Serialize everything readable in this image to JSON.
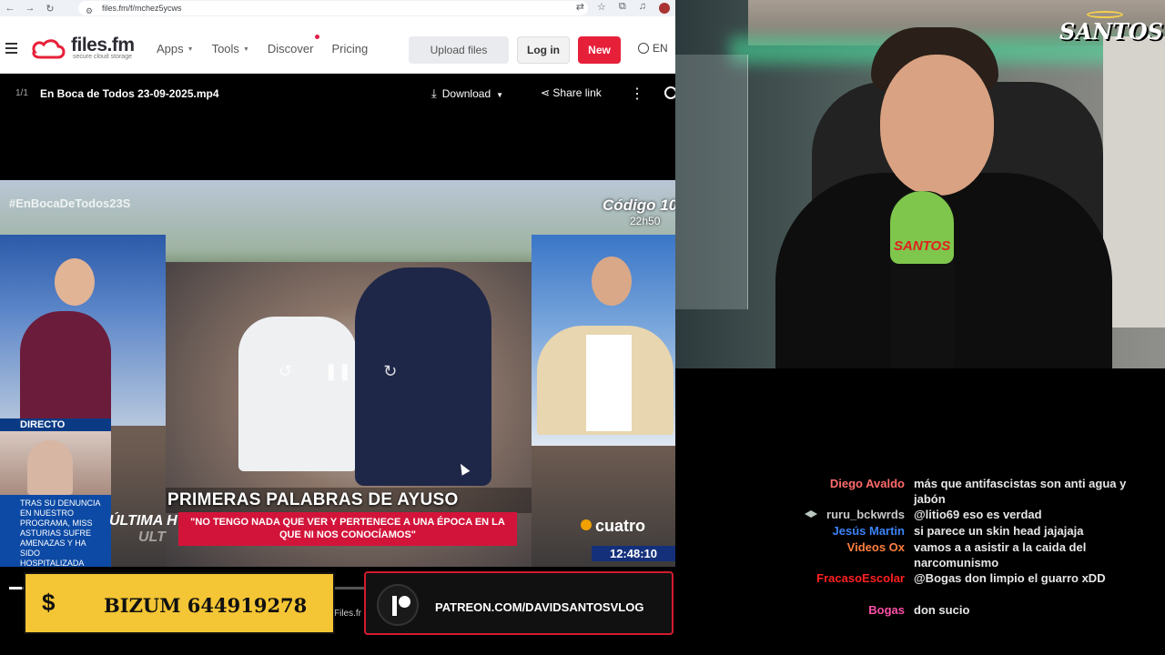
{
  "browser": {
    "url": "files.fm/f/mchez5ycws",
    "colors": {
      "brand_red": "#e7203a",
      "chrome_bg": "#eef1f5"
    }
  },
  "site": {
    "logo_text": "files.fm",
    "logo_sub": "secure cloud storage",
    "menu": [
      {
        "label": "Apps",
        "has_caret": true
      },
      {
        "label": "Tools",
        "has_caret": true
      },
      {
        "label": "Discover",
        "has_caret": false
      },
      {
        "label": "Pricing",
        "has_caret": false
      }
    ],
    "upload_label": "Upload files",
    "login_label": "Log in",
    "new_label": "New",
    "lang_label": "EN"
  },
  "file": {
    "count": "1/1",
    "name": "En Boca de Todos 23-09-2025.mp4",
    "download_label": "Download",
    "share_label": "Share link"
  },
  "video": {
    "hashtag": "#EnBocaDeTodos23S",
    "channel_show": "Código 10",
    "show_time": "22h50",
    "directo": "DIRECTO",
    "inset_text": "TRAS SU DENUNCIA EN NUESTRO PROGRAMA, MISS ASTURIAS SUFRE AMENAZAS Y HA SIDO HOSPITALIZADA",
    "headline": "PRIMERAS PALABRAS DE AYUSO",
    "quote": "\"NO TENGO NADA QUE VER Y PERTENECE A UNA ÉPOCA EN LA QUE NI NOS CONOCÍAMOS\"",
    "ultima": "ÚLTIMA H",
    "ultima2": "ULT",
    "channel": "cuatro",
    "clock": "12:48:10",
    "progress": 0.02
  },
  "overlays": {
    "bizum_icon": "$",
    "bizum_text": "BIZUM 644919278",
    "patreon_text": "PATREON.COM/DAVIDSANTOSVLOG",
    "files_text": "Files.fr"
  },
  "cam": {
    "logo": "SANTOS",
    "mic_label": "SANTOS"
  },
  "chat": {
    "messages": [
      {
        "user": "Diego Avaldo",
        "color": "#ff6b6b",
        "text": "más que antifascistas son anti agua y jabón",
        "badge": false
      },
      {
        "user": "ruru_bckwrds",
        "color": "#c9c9c9",
        "text": "@litio69 eso es verdad",
        "badge": true
      },
      {
        "user": "Jesús Martin",
        "color": "#3b82f6",
        "text": "si parece un skin head jajajaja",
        "badge": false
      },
      {
        "user": "Videos Ox",
        "color": "#ff7f3f",
        "text": "vamos a a asistir a la caida del narcomunismo",
        "badge": false
      },
      {
        "user": "FracasoEscolar",
        "color": "#ff2020",
        "text": "@Bogas don limpio el guarro xDD",
        "badge": false
      },
      {
        "user": "Bogas",
        "color": "#ff4fa8",
        "text": "don sucio",
        "badge": false
      }
    ]
  }
}
